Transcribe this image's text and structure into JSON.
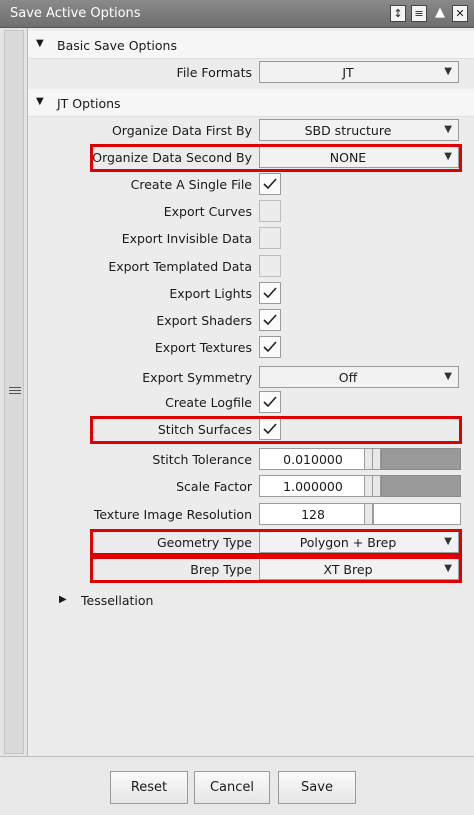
{
  "window": {
    "title": "Save Active Options",
    "icons": [
      "expand-icon",
      "menu-icon",
      "collapse-up-icon",
      "close-icon"
    ]
  },
  "sections": {
    "basic": {
      "label": "Basic Save Options",
      "expanded": true
    },
    "jt": {
      "label": "JT Options",
      "expanded": true
    },
    "tessellation": {
      "label": "Tessellation",
      "expanded": false
    }
  },
  "fields": {
    "file_formats": {
      "label": "File Formats",
      "value": "JT"
    },
    "organize_first": {
      "label": "Organize Data First By",
      "value": "SBD structure"
    },
    "organize_second": {
      "label": "Organize Data Second By",
      "value": "NONE"
    },
    "create_single_file": {
      "label": "Create A Single File",
      "checked": true
    },
    "export_curves": {
      "label": "Export Curves",
      "checked": false
    },
    "export_invisible": {
      "label": "Export Invisible Data",
      "checked": false
    },
    "export_templated": {
      "label": "Export Templated Data",
      "checked": false
    },
    "export_lights": {
      "label": "Export Lights",
      "checked": true
    },
    "export_shaders": {
      "label": "Export Shaders",
      "checked": true
    },
    "export_textures": {
      "label": "Export Textures",
      "checked": true
    },
    "export_symmetry": {
      "label": "Export Symmetry",
      "value": "Off"
    },
    "create_logfile": {
      "label": "Create Logfile",
      "checked": true
    },
    "stitch_surfaces": {
      "label": "Stitch Surfaces",
      "checked": true
    },
    "stitch_tolerance": {
      "label": "Stitch Tolerance",
      "value": "0.010000"
    },
    "scale_factor": {
      "label": "Scale Factor",
      "value": "1.000000"
    },
    "texture_resolution": {
      "label": "Texture Image Resolution",
      "value": "128"
    },
    "geometry_type": {
      "label": "Geometry Type",
      "value": "Polygon + Brep"
    },
    "brep_type": {
      "label": "Brep Type",
      "value": "XT Brep"
    }
  },
  "buttons": {
    "reset": "Reset",
    "cancel": "Cancel",
    "save": "Save"
  },
  "colors": {
    "highlight": "#e00000",
    "titlebar": "#7a7a7a"
  }
}
